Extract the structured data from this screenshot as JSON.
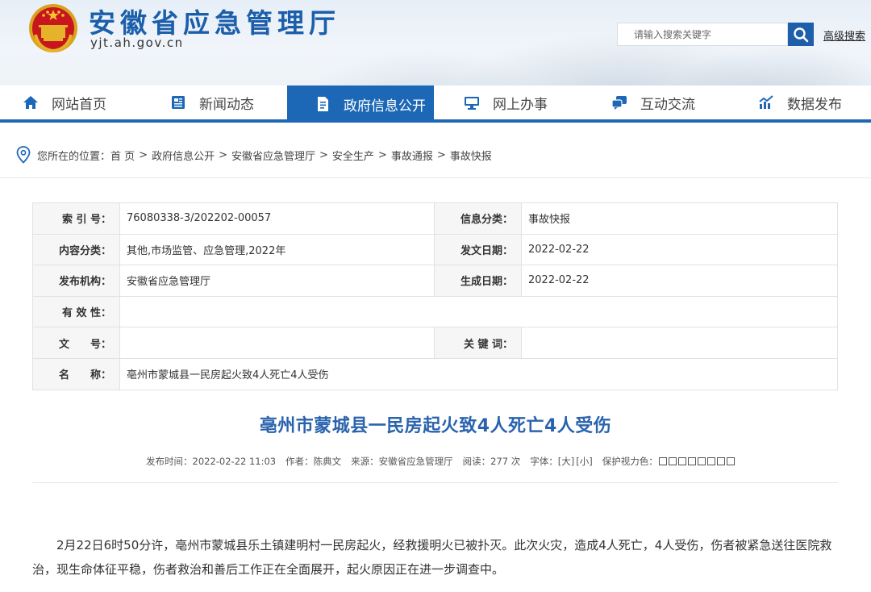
{
  "site": {
    "title": "安徽省应急管理厅",
    "domain": "yjt.ah.gov.cn",
    "search_placeholder": "请输入搜索关键字",
    "advanced_search": "高级搜索",
    "brand_color": "#1d68b6"
  },
  "nav": {
    "items": [
      {
        "label": "网站首页",
        "icon": "home-icon"
      },
      {
        "label": "新闻动态",
        "icon": "news-icon"
      },
      {
        "label": "政府信息公开",
        "icon": "document-icon",
        "active": true
      },
      {
        "label": "网上办事",
        "icon": "monitor-icon"
      },
      {
        "label": "互动交流",
        "icon": "chat-icon"
      },
      {
        "label": "数据发布",
        "icon": "chart-icon"
      }
    ]
  },
  "breadcrumb": {
    "prefix": "您所在的位置：",
    "items": [
      "首 页",
      "政府信息公开",
      "安徽省应急管理厅",
      "安全生产",
      "事故通报",
      "事故快报"
    ],
    "separator": ">"
  },
  "info_table": {
    "index_label": "索 引 号：",
    "index_value": "76080338-3/202202-00057",
    "category_label": "信息分类：",
    "category_value": "事故快报",
    "content_label": "内容分类：",
    "content_value": "其他,市场监管、应急管理,2022年",
    "issue_date_label": "发文日期：",
    "issue_date_value": "2022-02-22",
    "publisher_label": "发布机构：",
    "publisher_value": "安徽省应急管理厅",
    "gen_date_label": "生成日期：",
    "gen_date_value": "2022-02-22",
    "validity_label": "有 效 性：",
    "validity_value": "",
    "doc_no_label": "文　　号：",
    "doc_no_value": "",
    "keywords_label": "关 键 词：",
    "keywords_value": "",
    "name_label": "名　　称：",
    "name_value": "亳州市蒙城县一民房起火致4人死亡4人受伤"
  },
  "article": {
    "title": "亳州市蒙城县一民房起火致4人死亡4人受伤",
    "publish_time": "发布时间：2022-02-22 11:03",
    "author": "作者：陈典文",
    "source": "来源：安徽省应急管理厅",
    "views": "阅读：277 次",
    "font_label": "字体：",
    "font_large": "[大]",
    "font_small": "[小]",
    "color_label": "保护视力色：",
    "body": "2月22日6时50分许，亳州市蒙城县乐土镇建明村一民房起火，经救援明火已被扑灭。此次火灾，造成4人死亡，4人受伤，伤者被紧急送往医院救治，现生命体征平稳，伤者救治和善后工作正在全面展开，起火原因正在进一步调查中。"
  }
}
